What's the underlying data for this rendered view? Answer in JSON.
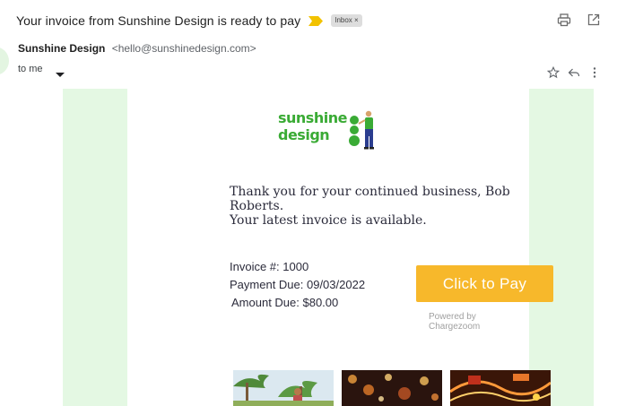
{
  "email": {
    "subject": "Your invoice from Sunshine Design is ready to pay",
    "label": "Inbox ×",
    "sender_name": "Sunshine Design",
    "sender_email": "<hello@sunshinedesign.com>",
    "recipient": "to me"
  },
  "icons": {
    "print": "print-icon",
    "open_new": "open-in-new-window-icon",
    "star": "star-icon",
    "reply": "reply-icon",
    "more": "more-vertical-icon",
    "importance": "importance-marker-icon"
  },
  "logo": {
    "line1": "sunshine",
    "line2": "design"
  },
  "body": {
    "greeting": "Thank you for your continued business, Bob Roberts.",
    "notice": "Your latest invoice is available.",
    "invoice_number": "Invoice #: 1000",
    "payment_due": "Payment Due: 09/03/2022",
    "amount_due": "Amount Due: $80.00",
    "pay_button": "Click to Pay",
    "powered_by": "Powered by Chargezoom"
  },
  "colors": {
    "brand_green": "#3aab35",
    "pay_button": "#f7b82b",
    "body_background": "#e4f8e3",
    "importance_marker": "#f2c200"
  }
}
